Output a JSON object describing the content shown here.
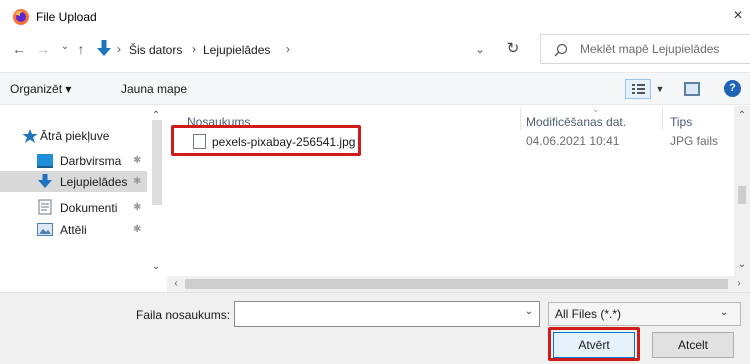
{
  "window": {
    "title": "File Upload",
    "close": "×"
  },
  "address": {
    "back": "←",
    "forward": "→",
    "recent": "⌄",
    "up": "↑",
    "crumbs": [
      "Šis dators",
      "Lejupielādes"
    ],
    "separator": "›",
    "dropdown": "⌄",
    "refresh": "↻",
    "search_placeholder": "Meklēt mapē Lejupielādes"
  },
  "toolbar": {
    "organize": "Organizēt ▾",
    "new_folder": "Jauna mape",
    "help": "?"
  },
  "nav": {
    "items": [
      {
        "label": "Ātrā piekļuve",
        "icon": "star-icon",
        "color": "#1e73be"
      },
      {
        "label": "Darbvirsma",
        "icon": "desktop-icon",
        "color": "#1e8fd7",
        "pin": "✱"
      },
      {
        "label": "Lejupielādes",
        "icon": "download-icon",
        "color": "#1e73be",
        "pin": "✱",
        "selected": true
      },
      {
        "label": "Dokumenti",
        "icon": "document-icon",
        "color": "#6f7a86",
        "pin": "✱"
      },
      {
        "label": "Attēli",
        "icon": "pictures-icon",
        "color": "#4a7fb5",
        "pin": "✱"
      }
    ]
  },
  "list": {
    "columns": [
      "Nosaukums",
      "Modificēšanas dat.",
      "Tips"
    ],
    "files": [
      {
        "name": "pexels-pixabay-256541.jpg",
        "modified": "04.06.2021 10:41",
        "type": "JPG fails"
      }
    ]
  },
  "bottom": {
    "filename_label": "Faila nosaukums:",
    "filename_value": "",
    "filter": "All Files (*.*)",
    "open_button": "Atvērt",
    "cancel_button": "Atcelt"
  },
  "colors": {
    "highlight": "#d11a1a",
    "accent": "#0078d7"
  }
}
